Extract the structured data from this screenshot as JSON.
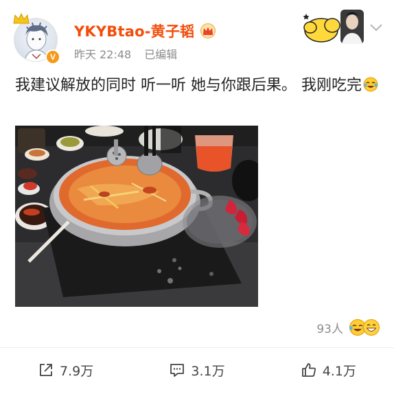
{
  "post": {
    "author": {
      "username": "YKYBtao-黄子韬",
      "verified_icon": "verified-v-badge",
      "vip_icon": "crown-icon"
    },
    "meta": {
      "time": "昨天 22:48",
      "edited": "已编辑"
    },
    "content": {
      "text": "我建议解放的同时 听一听 她与你跟后果。 我刚吃完",
      "emoji": "laughing-tears-emoji"
    },
    "image": {
      "icon": "hotpot-photo"
    },
    "likes": {
      "count": "93人",
      "emoji": [
        "laughing-tears-emoji",
        "grinning-emoji"
      ]
    },
    "actions": {
      "repost": {
        "icon": "share-icon",
        "label": "7.9万"
      },
      "comment": {
        "icon": "comment-icon",
        "label": "3.1万"
      },
      "like": {
        "icon": "thumbs-up-icon",
        "label": "4.1万"
      }
    }
  },
  "colors": {
    "username": "#f24d0a",
    "meta": "#8c8c8c",
    "verified": "#f59a1b",
    "divider": "#ececec"
  }
}
